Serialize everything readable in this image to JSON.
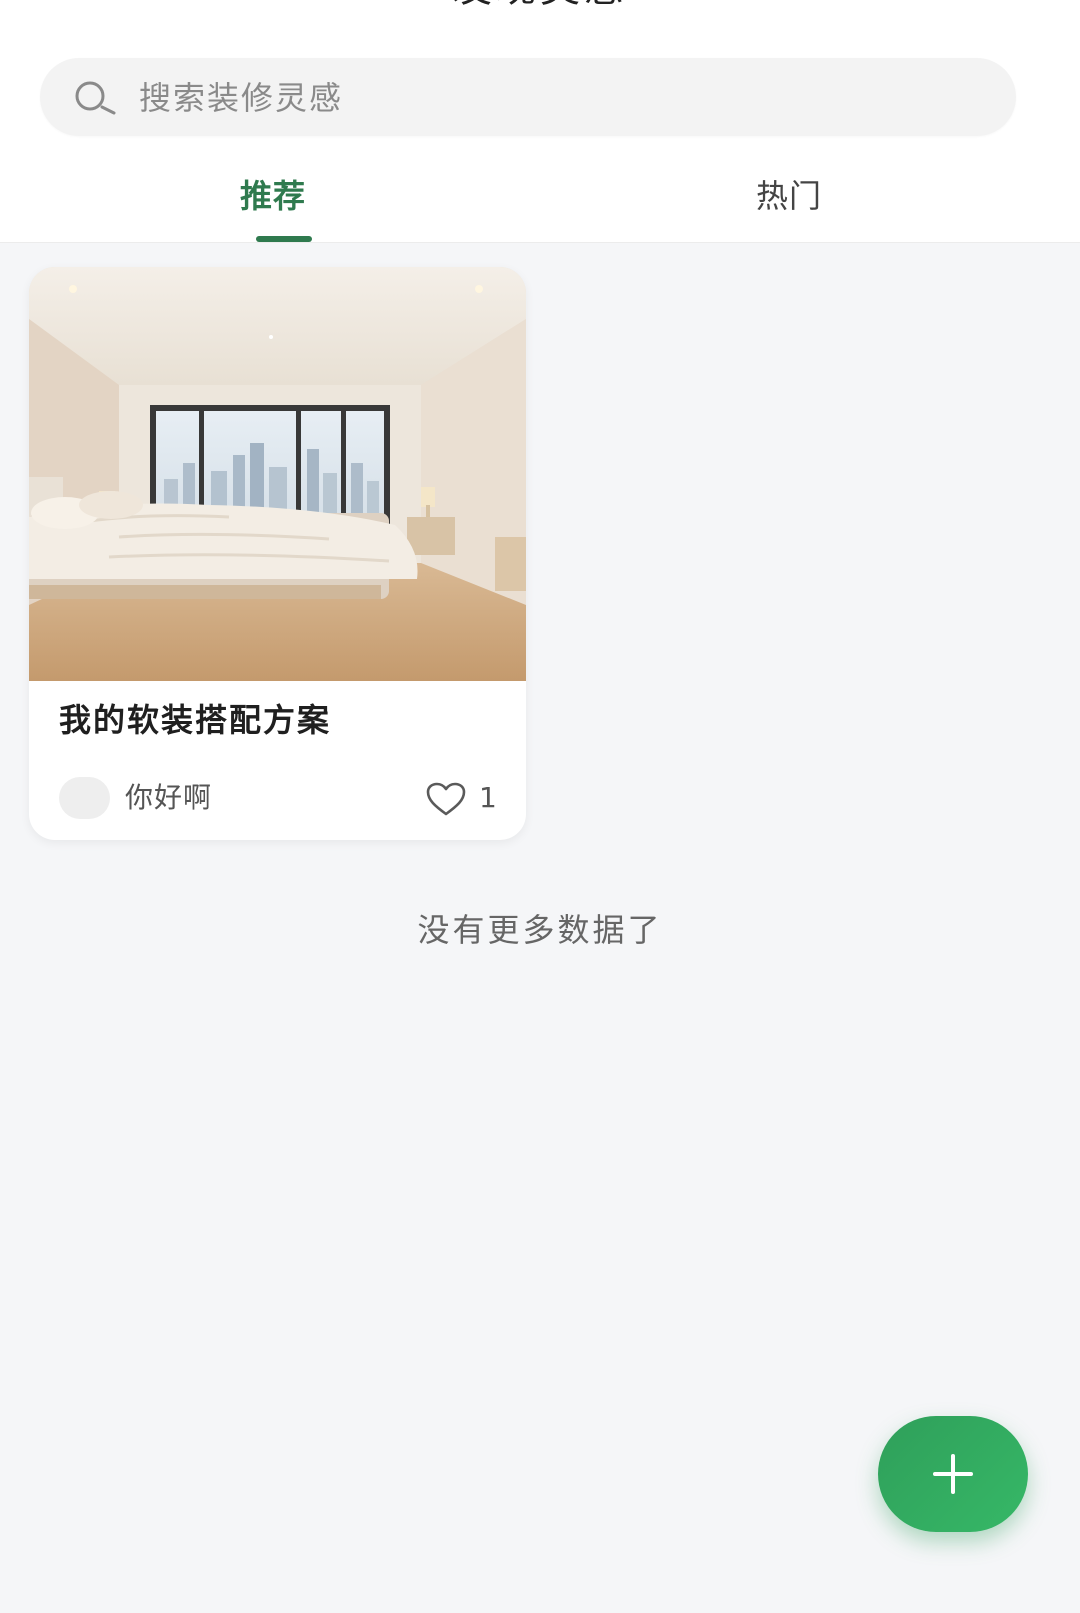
{
  "header": {
    "title": "发现灵感",
    "search": {
      "placeholder": "搜索装修灵感"
    },
    "tabs": [
      {
        "label": "推荐",
        "active": true
      },
      {
        "label": "热门",
        "active": false
      }
    ]
  },
  "feed": {
    "cards": [
      {
        "title": "我的软装搭配方案",
        "author": "你好啊",
        "likes": "1",
        "image": "bedroom-photo"
      }
    ],
    "end_text": "没有更多数据了"
  },
  "fab": {
    "icon": "plus-icon"
  },
  "colors": {
    "accent": "#2f7a4e",
    "fab": "#34b565",
    "background": "#f5f6f8"
  }
}
